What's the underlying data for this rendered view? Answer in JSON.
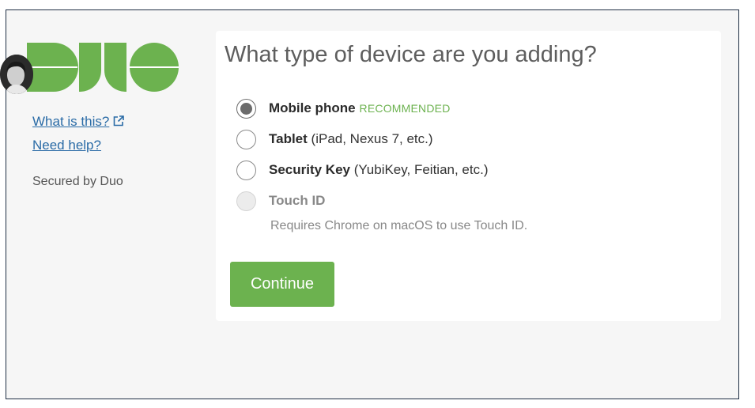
{
  "sidebar": {
    "what_is_this": "What is this?",
    "need_help": "Need help?",
    "secured_by": "Secured by Duo"
  },
  "main": {
    "title": "What type of device are you adding?",
    "options": [
      {
        "label": "Mobile phone",
        "extra": "",
        "tag": "RECOMMENDED",
        "checked": true,
        "disabled": false
      },
      {
        "label": "Tablet",
        "extra": " (iPad, Nexus 7, etc.)",
        "tag": "",
        "checked": false,
        "disabled": false
      },
      {
        "label": "Security Key",
        "extra": " (YubiKey, Feitian, etc.)",
        "tag": "",
        "checked": false,
        "disabled": false
      },
      {
        "label": "Touch ID",
        "extra": "",
        "tag": "",
        "checked": false,
        "disabled": true
      }
    ],
    "touch_id_note": "Requires Chrome on macOS to use Touch ID.",
    "continue_label": "Continue"
  },
  "colors": {
    "brand_green": "#6cb24f",
    "link_blue": "#2a6ba6"
  }
}
